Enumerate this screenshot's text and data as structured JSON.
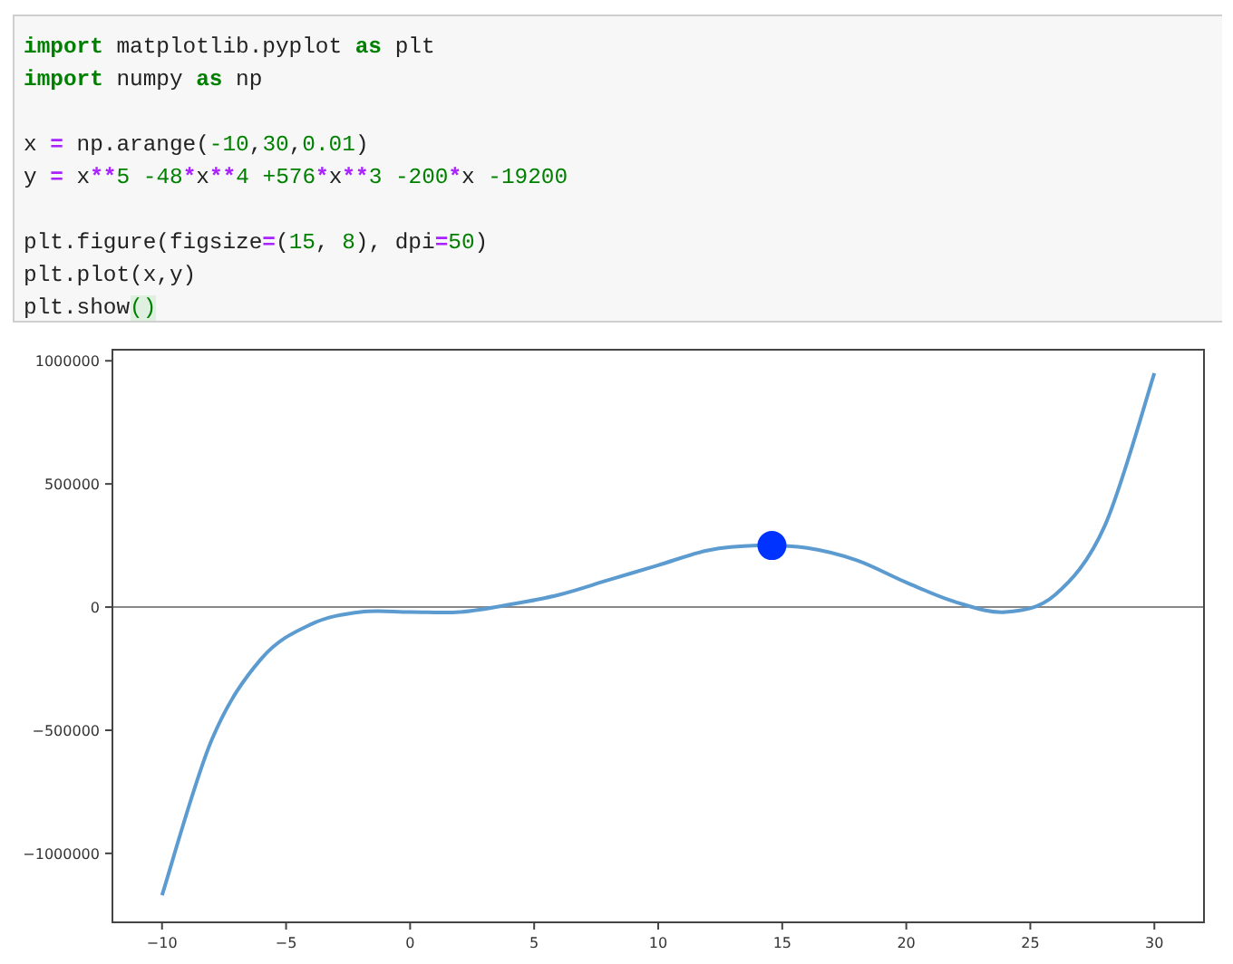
{
  "code_cell": {
    "lines": [
      {
        "kind": "code",
        "tokens": [
          {
            "kind": "keyword",
            "text": "import"
          },
          {
            "kind": "name",
            "text": " matplotlib.pyplot "
          },
          {
            "kind": "keyword",
            "text": "as"
          },
          {
            "kind": "name",
            "text": " plt"
          }
        ]
      },
      {
        "kind": "code",
        "tokens": [
          {
            "kind": "keyword",
            "text": "import"
          },
          {
            "kind": "name",
            "text": " numpy "
          },
          {
            "kind": "keyword",
            "text": "as"
          },
          {
            "kind": "name",
            "text": " np"
          }
        ]
      },
      {
        "kind": "blank"
      },
      {
        "kind": "code",
        "tokens": [
          {
            "kind": "name",
            "text": "x "
          },
          {
            "kind": "op",
            "text": "="
          },
          {
            "kind": "name",
            "text": " np.arange("
          },
          {
            "kind": "number",
            "text": "-10"
          },
          {
            "kind": "name",
            "text": ","
          },
          {
            "kind": "number",
            "text": "30"
          },
          {
            "kind": "name",
            "text": ","
          },
          {
            "kind": "number",
            "text": "0.01"
          },
          {
            "kind": "name",
            "text": ")"
          }
        ]
      },
      {
        "kind": "code",
        "tokens": [
          {
            "kind": "name",
            "text": "y "
          },
          {
            "kind": "op",
            "text": "="
          },
          {
            "kind": "name",
            "text": " x"
          },
          {
            "kind": "op",
            "text": "**"
          },
          {
            "kind": "number",
            "text": "5 -48"
          },
          {
            "kind": "op",
            "text": "*"
          },
          {
            "kind": "name",
            "text": "x"
          },
          {
            "kind": "op",
            "text": "**"
          },
          {
            "kind": "number",
            "text": "4 +576"
          },
          {
            "kind": "op",
            "text": "*"
          },
          {
            "kind": "name",
            "text": "x"
          },
          {
            "kind": "op",
            "text": "**"
          },
          {
            "kind": "number",
            "text": "3 -200"
          },
          {
            "kind": "op",
            "text": "*"
          },
          {
            "kind": "name",
            "text": "x "
          },
          {
            "kind": "number",
            "text": "-19200"
          }
        ]
      },
      {
        "kind": "blank"
      },
      {
        "kind": "code",
        "tokens": [
          {
            "kind": "name",
            "text": "plt.figure(figsize"
          },
          {
            "kind": "op",
            "text": "="
          },
          {
            "kind": "name",
            "text": "("
          },
          {
            "kind": "number",
            "text": "15"
          },
          {
            "kind": "name",
            "text": ", "
          },
          {
            "kind": "number",
            "text": "8"
          },
          {
            "kind": "name",
            "text": "), dpi"
          },
          {
            "kind": "op",
            "text": "="
          },
          {
            "kind": "number",
            "text": "50"
          },
          {
            "kind": "name",
            "text": ")"
          }
        ]
      },
      {
        "kind": "code",
        "tokens": [
          {
            "kind": "name",
            "text": "plt.plot(x,y)"
          }
        ]
      },
      {
        "kind": "code",
        "tokens": [
          {
            "kind": "name",
            "text": "plt.show"
          },
          {
            "kind": "match",
            "text": "()"
          }
        ]
      }
    ]
  },
  "output": {
    "chart_data": {
      "type": "line",
      "x": [
        -10,
        -8,
        -6,
        -4,
        -2,
        0,
        2,
        4,
        6,
        8,
        10,
        12,
        14,
        16,
        18,
        20,
        22,
        24,
        26,
        28,
        30
      ],
      "series": [
        {
          "color": "#5b9bd0",
          "values": [
            -1170000,
            -540000,
            -210000,
            -70000,
            -20000,
            -20000,
            -20000,
            10000,
            50000,
            110000,
            170000,
            230000,
            250000,
            240000,
            190000,
            100000,
            20000,
            -20000,
            50000,
            330000,
            950000
          ]
        }
      ],
      "xlim": [
        -12,
        32
      ],
      "ylim": [
        -1280000,
        1045000
      ],
      "xticks": [
        {
          "value": -10,
          "label": "−10"
        },
        {
          "value": -5,
          "label": "−5"
        },
        0,
        5,
        10,
        15,
        20,
        25,
        30
      ],
      "yticks": [
        {
          "value": -1000000,
          "label": "−1000000"
        },
        {
          "value": -500000,
          "label": "−500000"
        },
        0,
        500000,
        1000000
      ]
    }
  }
}
